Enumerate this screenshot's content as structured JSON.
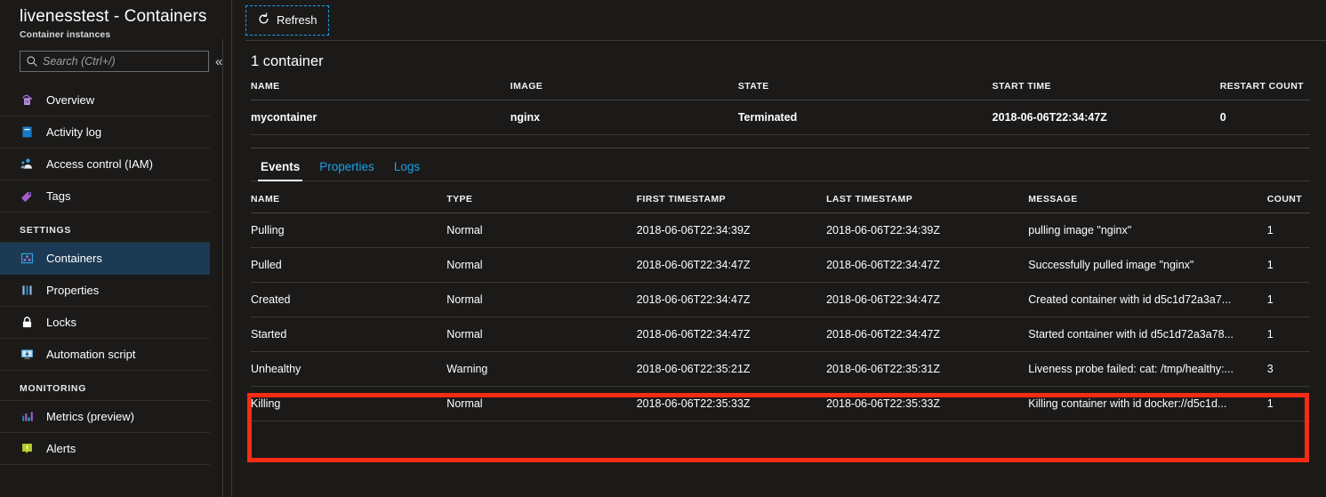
{
  "blade": {
    "title": "livenesstest - Containers",
    "subtitle": "Container instances",
    "collapse_icon": "«"
  },
  "search": {
    "placeholder": "Search (Ctrl+/)",
    "value": "",
    "icon": "search-icon"
  },
  "sidebar": {
    "items": [
      {
        "label": "Overview",
        "icon": "overview-cloud-icon",
        "selected": false
      },
      {
        "label": "Activity log",
        "icon": "activity-log-book-icon",
        "selected": false
      },
      {
        "label": "Access control (IAM)",
        "icon": "access-control-people-icon",
        "selected": false
      },
      {
        "label": "Tags",
        "icon": "tag-icon",
        "selected": false
      }
    ],
    "groups": [
      {
        "label": "SETTINGS",
        "items": [
          {
            "label": "Containers",
            "icon": "containers-icon",
            "selected": true
          },
          {
            "label": "Properties",
            "icon": "properties-bars-icon",
            "selected": false
          },
          {
            "label": "Locks",
            "icon": "lock-icon",
            "selected": false
          },
          {
            "label": "Automation script",
            "icon": "automation-script-monitor-icon",
            "selected": false
          }
        ]
      },
      {
        "label": "MONITORING",
        "items": [
          {
            "label": "Metrics (preview)",
            "icon": "metrics-chart-icon",
            "selected": false
          },
          {
            "label": "Alerts",
            "icon": "alerts-warning-icon",
            "selected": false
          }
        ]
      }
    ]
  },
  "toolbar": {
    "refresh_label": "Refresh",
    "refresh_icon": "refresh-icon"
  },
  "containers_section": {
    "count_title": "1 container",
    "columns": [
      "NAME",
      "IMAGE",
      "STATE",
      "START TIME",
      "RESTART COUNT"
    ],
    "rows": [
      {
        "name": "mycontainer",
        "image": "nginx",
        "state": "Terminated",
        "start_time": "2018-06-06T22:34:47Z",
        "restart_count": "0"
      }
    ]
  },
  "tabs": [
    {
      "label": "Events",
      "active": true
    },
    {
      "label": "Properties",
      "active": false
    },
    {
      "label": "Logs",
      "active": false
    }
  ],
  "events_section": {
    "columns": [
      "NAME",
      "TYPE",
      "FIRST TIMESTAMP",
      "LAST TIMESTAMP",
      "MESSAGE",
      "COUNT"
    ],
    "rows": [
      {
        "name": "Pulling",
        "type": "Normal",
        "first_timestamp": "2018-06-06T22:34:39Z",
        "last_timestamp": "2018-06-06T22:34:39Z",
        "message": "pulling image \"nginx\"",
        "count": "1",
        "highlighted": false
      },
      {
        "name": "Pulled",
        "type": "Normal",
        "first_timestamp": "2018-06-06T22:34:47Z",
        "last_timestamp": "2018-06-06T22:34:47Z",
        "message": "Successfully pulled image \"nginx\"",
        "count": "1",
        "highlighted": false
      },
      {
        "name": "Created",
        "type": "Normal",
        "first_timestamp": "2018-06-06T22:34:47Z",
        "last_timestamp": "2018-06-06T22:34:47Z",
        "message": "Created container with id d5c1d72a3a7...",
        "count": "1",
        "highlighted": false
      },
      {
        "name": "Started",
        "type": "Normal",
        "first_timestamp": "2018-06-06T22:34:47Z",
        "last_timestamp": "2018-06-06T22:34:47Z",
        "message": "Started container with id d5c1d72a3a78...",
        "count": "1",
        "highlighted": false
      },
      {
        "name": "Unhealthy",
        "type": "Warning",
        "first_timestamp": "2018-06-06T22:35:21Z",
        "last_timestamp": "2018-06-06T22:35:31Z",
        "message": "Liveness probe failed: cat: /tmp/healthy:...",
        "count": "3",
        "highlighted": true
      },
      {
        "name": "Killing",
        "type": "Normal",
        "first_timestamp": "2018-06-06T22:35:33Z",
        "last_timestamp": "2018-06-06T22:35:33Z",
        "message": "Killing container with id docker://d5c1d...",
        "count": "1",
        "highlighted": true
      }
    ]
  },
  "annotation": {
    "highlight_color": "#f72c14",
    "label": "unhealthy-killing-highlight"
  },
  "colors": {
    "background": "#1b1a19",
    "accent_blue": "#1ca0e8",
    "selected_nav": "#1c3a53",
    "highlight_red": "#f72c14"
  }
}
